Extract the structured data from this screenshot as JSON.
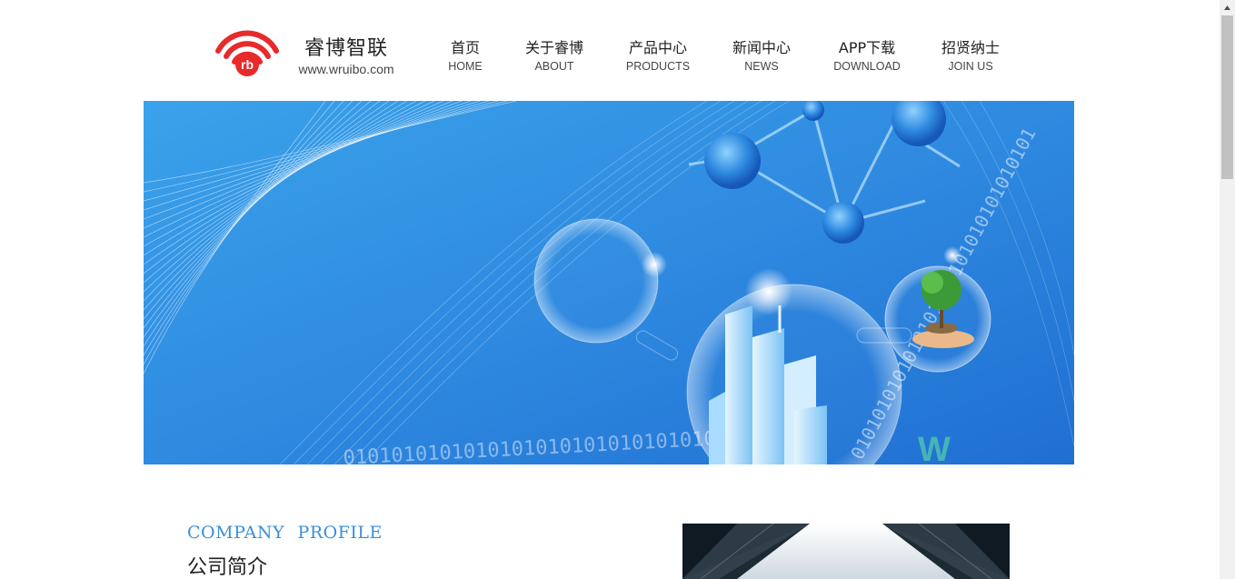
{
  "brand": {
    "name": "睿博智联",
    "url": "www.wruibo.com",
    "logo_letters": "rb",
    "logo_color": "#e82a2a"
  },
  "nav": [
    {
      "cn": "首页",
      "en": "HOME"
    },
    {
      "cn": "关于睿博",
      "en": "ABOUT"
    },
    {
      "cn": "产品中心",
      "en": "PRODUCTS"
    },
    {
      "cn": "新闻中心",
      "en": "NEWS"
    },
    {
      "cn": "APP下载",
      "en": "DOWNLOAD"
    },
    {
      "cn": "招贤纳士",
      "en": "JOIN US"
    }
  ],
  "banner": {
    "binary_text": "0101010101010101010101010101010101",
    "watermark": "W"
  },
  "profile": {
    "title_en": "COMPANY  PROFILE",
    "title_cn": "公司简介"
  },
  "colors": {
    "accent": "#3a8fd8",
    "banner_blue": "#2f8ae0"
  }
}
